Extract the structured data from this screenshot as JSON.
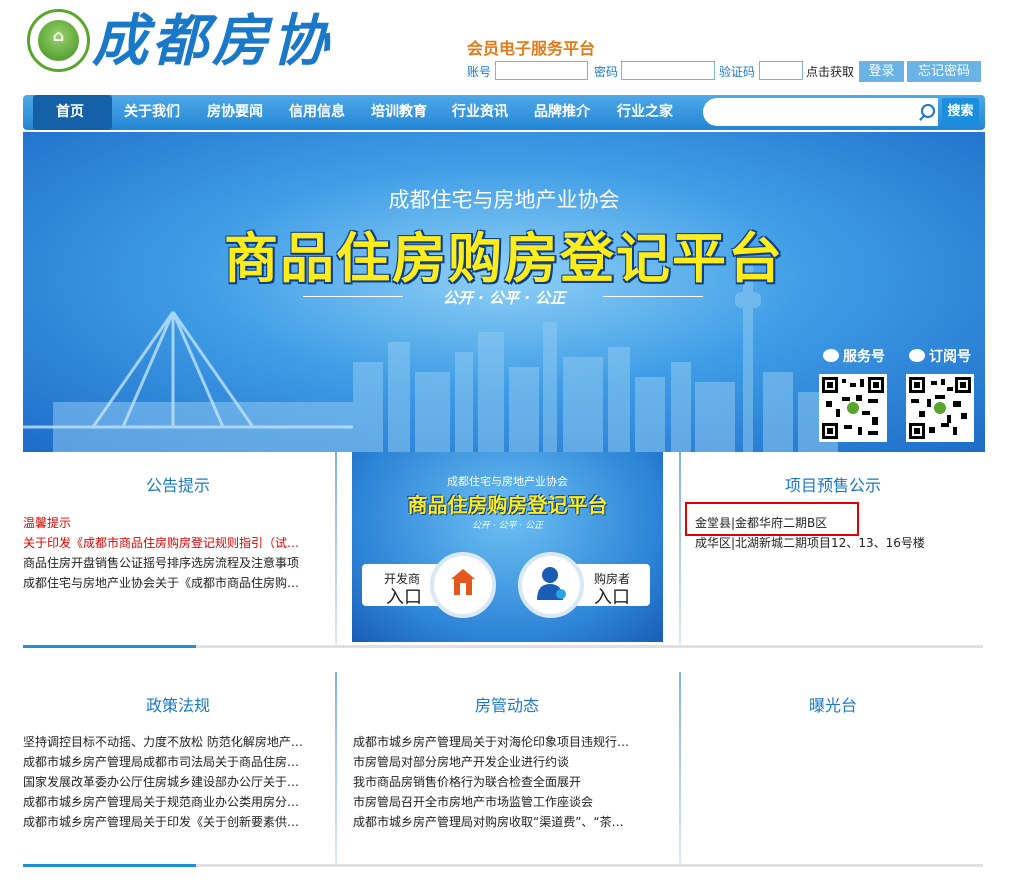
{
  "header": {
    "logo_text": "成都房协",
    "member_title": "会员电子服务平台",
    "account_label": "账号",
    "password_label": "密码",
    "captcha_label": "验证码",
    "captcha_action": "点击获取",
    "login_button": "登录",
    "forgot_button": "忘记密码"
  },
  "nav": {
    "items": [
      "首页",
      "关于我们",
      "房协要闻",
      "信用信息",
      "培训教育",
      "行业资讯",
      "品牌推介",
      "行业之家"
    ],
    "search_placeholder": "",
    "search_button": "搜索"
  },
  "banner": {
    "subtitle": "成都住宅与房地产业协会",
    "title": "商品住房购房登记平台",
    "slogan": "公开 · 公平 · 公正",
    "qr_service_label": "服务号",
    "qr_subscribe_label": "订阅号"
  },
  "notice": {
    "title": "公告提示",
    "items": [
      "温馨提示",
      "关于印发《成都市商品住房购房登记规则指引（试行）》的通知",
      "商品住房开盘销售公证摇号排序选房流程及注意事项",
      "成都住宅与房地产业协会关于《成都市商品住房购房登记规则指引》的说明"
    ]
  },
  "registration": {
    "subtitle": "成都住宅与房地产业协会",
    "title": "商品住房购房登记平台",
    "slogan": "公开 · 公平 · 公正",
    "developer_top": "开发商",
    "developer_bottom": "入口",
    "buyer_top": "购房者",
    "buyer_bottom": "入口"
  },
  "presale": {
    "title": "项目预售公示",
    "items": [
      "金堂县|金都华府二期B区",
      "成华区|北湖新城二期项目12、13、16号楼"
    ]
  },
  "policy": {
    "title": "政策法规",
    "items": [
      "坚持调控目标不动摇、力度不放松 防范化解房地产市场风险",
      "成都市城乡房产管理局成都市司法局关于商品住房交易的通知",
      "国家发展改革委办公厅住房城乡建设部办公厅关于印发通知",
      "成都市城乡房产管理局关于规范商业办公类用房分割销售的通知",
      "成都市城乡房产管理局关于印发《关于创新要素供给的通知》"
    ]
  },
  "housing_news": {
    "title": "房管动态",
    "items": [
      "成都市城乡房产管理局关于对海伦印象项目违规行为的通报",
      "市房管局对部分房地产开发企业进行约谈",
      "我市商品房销售价格行为联合检查全面展开",
      "市房管局召开全市房地产市场监管工作座谈会",
      "成都市城乡房产管理局对购房收取“渠道费”、“茶水费”的通报"
    ]
  },
  "exposure": {
    "title": "曝光台"
  },
  "colors": {
    "accent": "#1a78c9",
    "nav_bg": "#2385d4",
    "orange": "#e07b1a",
    "red": "#e00000",
    "banner_yellow": "#ffec1a"
  }
}
